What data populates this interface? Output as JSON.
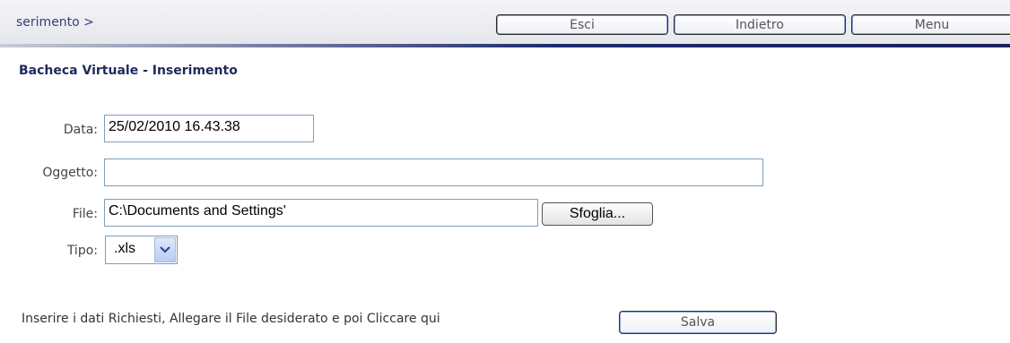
{
  "header": {
    "breadcrumb": "serimento >",
    "buttons": {
      "exit": "Esci",
      "back": "Indietro",
      "menu": "Menu"
    }
  },
  "page": {
    "title": "Bacheca Virtuale - Inserimento"
  },
  "form": {
    "date": {
      "label": "Data:",
      "value": "25/02/2010 16.43.38"
    },
    "subject": {
      "label": "Oggetto:",
      "value": ""
    },
    "file": {
      "label": "File:",
      "value": "C:\\Documents and Settings'",
      "browse_label": "Sfoglia..."
    },
    "type": {
      "label": "Tipo:",
      "selected": ".xls",
      "arrow_icon": "chevron-down-icon"
    }
  },
  "footer": {
    "instructions": "Inserire i dati Richiesti, Allegare il File desiderato e poi Cliccare qui",
    "save_label": "Salva"
  }
}
